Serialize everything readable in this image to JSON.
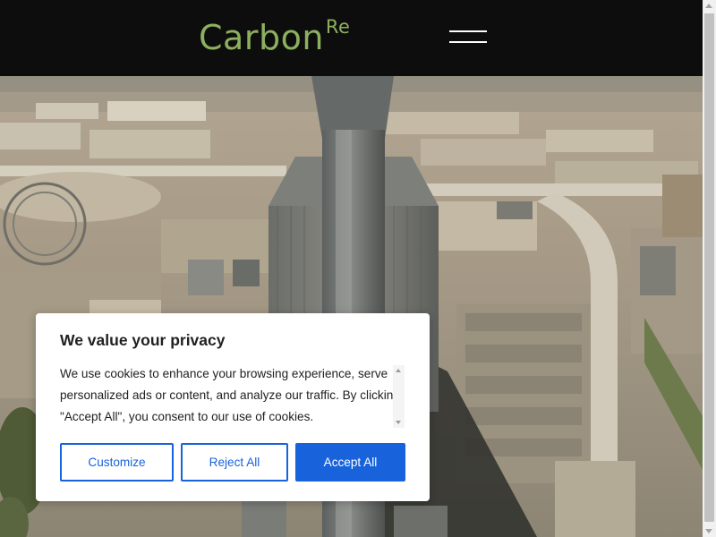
{
  "header": {
    "logo_text": "Carbon",
    "logo_superscript": "Re",
    "menu_icon": "hamburger-icon"
  },
  "colors": {
    "header_bg": "#0d0d0d",
    "logo": "#8cb05e",
    "primary": "#1863dc",
    "modal_bg": "#ffffff"
  },
  "cookie_banner": {
    "title": "We value your privacy",
    "message": "We use cookies to enhance your browsing experience, serve personalized ads or content, and analyze our traffic. By clicking \"Accept All\", you consent to our use of cookies.",
    "buttons": {
      "customize": "Customize",
      "reject": "Reject All",
      "accept": "Accept All"
    }
  }
}
